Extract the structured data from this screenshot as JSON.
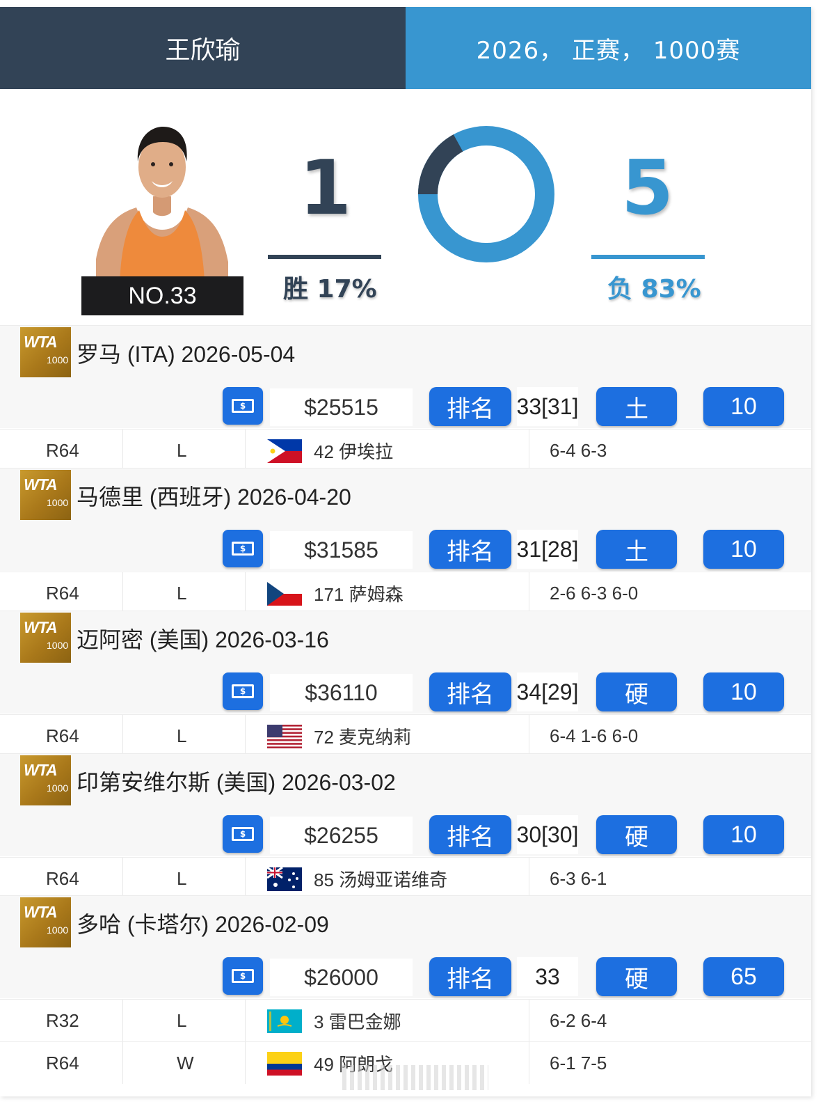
{
  "header": {
    "player_name": "王欣瑜",
    "filter": "2026， 正赛， 1000赛"
  },
  "profile": {
    "rank": "NO.33",
    "wins": "1",
    "losses": "5",
    "win_label": "胜 17%",
    "loss_label": "负 83%",
    "win_fraction": 0.17,
    "loss_fraction": 0.83,
    "colors": {
      "win": "#324356",
      "loss": "#3896d0",
      "accent": "#1d6fe0"
    }
  },
  "logo": {
    "wta": "WTA",
    "tier": "1000"
  },
  "tournaments": [
    {
      "title": "罗马 (ITA) 2026-05-04",
      "prize": "$25515",
      "rank_label": "排名",
      "rank": "33[31]",
      "surface": "土",
      "points": "10",
      "matches": [
        {
          "round": "R64",
          "result": "L",
          "flag": "philippines-flag",
          "opponent": "42 伊埃拉",
          "score": "6-4 6-3"
        }
      ]
    },
    {
      "title": "马德里 (西班牙) 2026-04-20",
      "prize": "$31585",
      "rank_label": "排名",
      "rank": "31[28]",
      "surface": "土",
      "points": "10",
      "matches": [
        {
          "round": "R64",
          "result": "L",
          "flag": "czech-flag",
          "opponent": "171 萨姆森",
          "score": "2-6 6-3 6-0"
        }
      ]
    },
    {
      "title": "迈阿密 (美国) 2026-03-16",
      "prize": "$36110",
      "rank_label": "排名",
      "rank": "34[29]",
      "surface": "硬",
      "points": "10",
      "matches": [
        {
          "round": "R64",
          "result": "L",
          "flag": "usa-flag",
          "opponent": "72 麦克纳莉",
          "score": "6-4 1-6 6-0"
        }
      ]
    },
    {
      "title": "印第安维尔斯 (美国) 2026-03-02",
      "prize": "$26255",
      "rank_label": "排名",
      "rank": "30[30]",
      "surface": "硬",
      "points": "10",
      "matches": [
        {
          "round": "R64",
          "result": "L",
          "flag": "australia-flag",
          "opponent": "85 汤姆亚诺维奇",
          "score": "6-3 6-1"
        }
      ]
    },
    {
      "title": "多哈 (卡塔尔) 2026-02-09",
      "prize": "$26000",
      "rank_label": "排名",
      "rank": "33",
      "surface": "硬",
      "points": "65",
      "matches": [
        {
          "round": "R32",
          "result": "L",
          "flag": "kazakhstan-flag",
          "opponent": "3 雷巴金娜",
          "score": "6-2 6-4"
        },
        {
          "round": "R64",
          "result": "W",
          "flag": "colombia-flag",
          "opponent": "49 阿朗戈",
          "score": "6-1 7-5"
        }
      ]
    }
  ]
}
